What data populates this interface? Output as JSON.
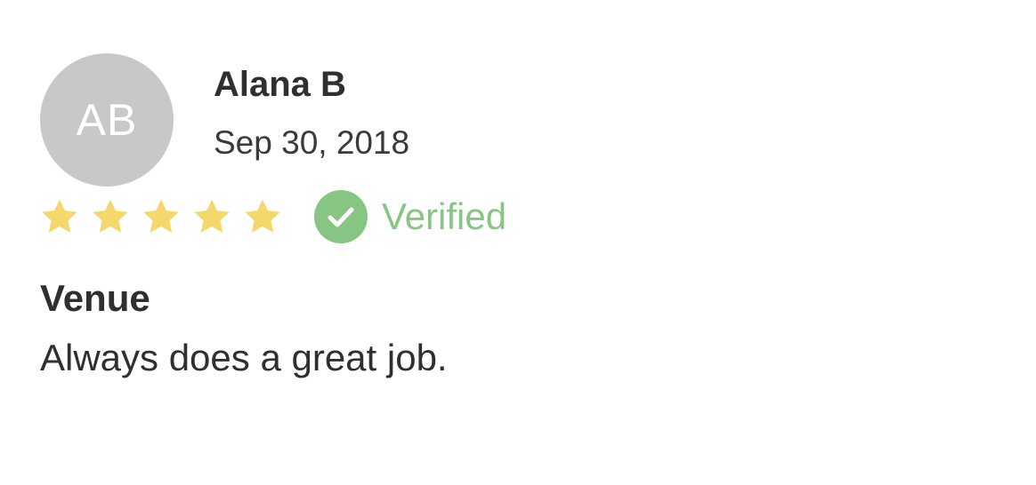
{
  "reviewer": {
    "initials": "AB",
    "name": "Alana B",
    "date": "Sep 30, 2018"
  },
  "rating": {
    "stars": 5,
    "max": 5,
    "star_color": "#f5d86b",
    "star_icon": "star-icon"
  },
  "verified": {
    "label": "Verified",
    "color": "#86c682",
    "icon": "check-circle-icon"
  },
  "review": {
    "title": "Venue",
    "body": "Always does a great job."
  },
  "colors": {
    "avatar_bg": "#c8c8c8",
    "text": "#2f2f2f"
  }
}
